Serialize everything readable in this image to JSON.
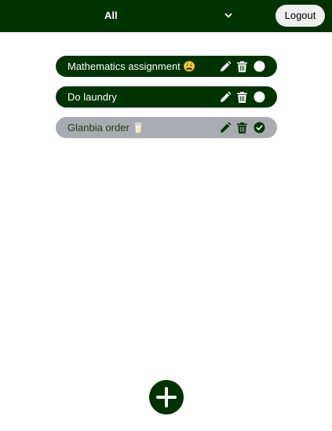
{
  "header": {
    "filter_label": "All",
    "logout_label": "Logout"
  },
  "todos": [
    {
      "text": "Mathematics assignment 😩",
      "completed": false
    },
    {
      "text": "Do laundry",
      "completed": false
    },
    {
      "text": "Glanbia order 🥛",
      "completed": true
    }
  ],
  "icons": {
    "filter_dropdown": "chevron-down-icon",
    "edit": "pencil-icon",
    "delete": "trash-icon",
    "status_incomplete": "circle-icon",
    "status_complete": "check-circle-icon",
    "add": "plus-icon"
  },
  "colors": {
    "brand": "#003300",
    "completed_item": "#a8abaf",
    "logout_button": "#efefef"
  }
}
